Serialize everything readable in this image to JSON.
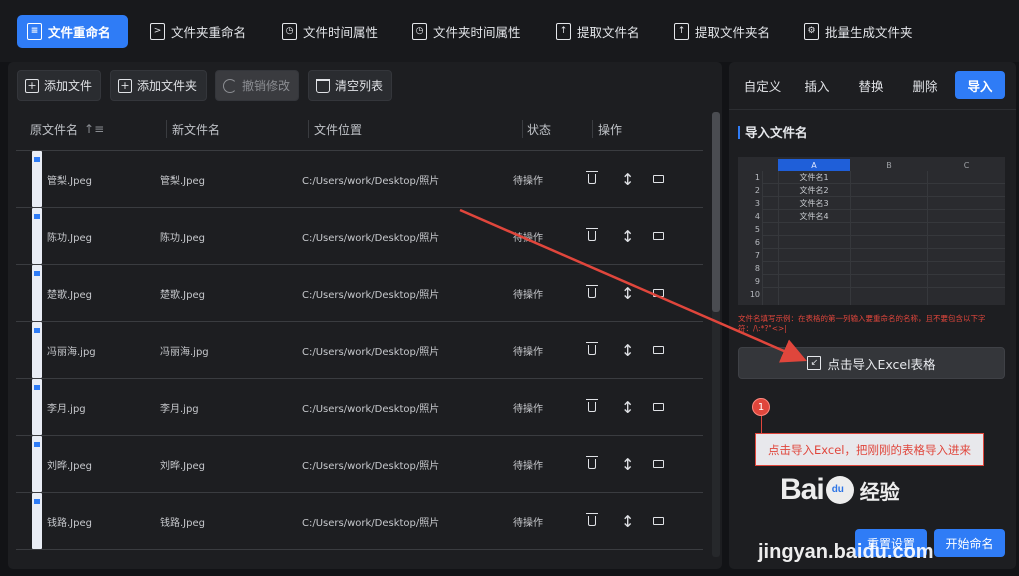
{
  "nav": {
    "items": [
      {
        "label": "文件重命名",
        "icon": "file-icon",
        "active": true
      },
      {
        "label": "文件夹重命名",
        "icon": "terminal-icon"
      },
      {
        "label": "文件时间属性",
        "icon": "clock-file-icon"
      },
      {
        "label": "文件夹时间属性",
        "icon": "clock-folder-icon"
      },
      {
        "label": "提取文件名",
        "icon": "extract-file-icon"
      },
      {
        "label": "提取文件夹名",
        "icon": "upload-file-icon"
      },
      {
        "label": "批量生成文件夹",
        "icon": "gear-folder-icon"
      }
    ]
  },
  "toolbar": {
    "add_file": "添加文件",
    "add_folder": "添加文件夹",
    "undo": "撤销修改",
    "clear": "清空列表"
  },
  "table": {
    "headers": {
      "orig": "原文件名",
      "new": "新文件名",
      "location": "文件位置",
      "status": "状态",
      "ops": "操作"
    },
    "rows": [
      {
        "orig": "管梨.Jpeg",
        "new": "管梨.Jpeg",
        "location": "C:/Users/work/Desktop/照片",
        "status": "待操作"
      },
      {
        "orig": "陈功.Jpeg",
        "new": "陈功.Jpeg",
        "location": "C:/Users/work/Desktop/照片",
        "status": "待操作"
      },
      {
        "orig": "楚歌.Jpeg",
        "new": "楚歌.Jpeg",
        "location": "C:/Users/work/Desktop/照片",
        "status": "待操作"
      },
      {
        "orig": "冯丽海.jpg",
        "new": "冯丽海.jpg",
        "location": "C:/Users/work/Desktop/照片",
        "status": "待操作"
      },
      {
        "orig": "李月.jpg",
        "new": "李月.jpg",
        "location": "C:/Users/work/Desktop/照片",
        "status": "待操作"
      },
      {
        "orig": "刘晔.Jpeg",
        "new": "刘晔.Jpeg",
        "location": "C:/Users/work/Desktop/照片",
        "status": "待操作"
      },
      {
        "orig": "钱路.Jpeg",
        "new": "钱路.Jpeg",
        "location": "C:/Users/work/Desktop/照片",
        "status": "待操作"
      }
    ]
  },
  "right": {
    "tabs": [
      {
        "label": "自定义"
      },
      {
        "label": "插入"
      },
      {
        "label": "替换"
      },
      {
        "label": "删除"
      },
      {
        "label": "导入",
        "active": true
      }
    ],
    "section_title": "导入文件名",
    "sheet": {
      "cols": [
        "A",
        "B",
        "C"
      ],
      "row_numbers": [
        "1",
        "2",
        "3",
        "4",
        "5",
        "6",
        "7",
        "8",
        "9",
        "10"
      ],
      "cells": [
        "文件名1",
        "文件名2",
        "文件名3",
        "文件名4"
      ]
    },
    "warning": "文件名填写示例：在表格的第一列输入要重命名的名称，且不要包含以下字符：/\\:*?\"<>|",
    "import_button": "点击导入Excel表格",
    "reset_button": "重置设置",
    "start_button": "开始命名"
  },
  "annotation": {
    "badge": "1",
    "text": "点击导入Excel，把刚刚的表格导入进来"
  },
  "watermark": {
    "bai": "Bai",
    "du": "du",
    "jingyan": "经验",
    "url": "jingyan.baidu.com"
  },
  "colors": {
    "accent": "#2f7cf6",
    "annotation": "#e0463c"
  }
}
